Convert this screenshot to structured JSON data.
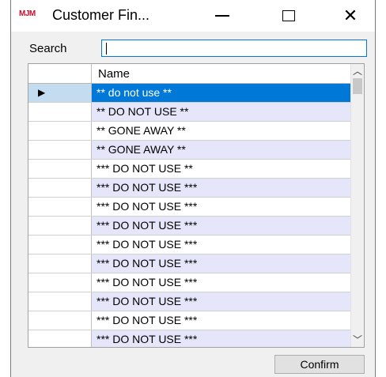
{
  "window": {
    "logo_text": "MJM",
    "title": "Customer Fin...",
    "min_glyph": "—",
    "close_glyph": "✕"
  },
  "search": {
    "label": "Search",
    "value": ""
  },
  "grid": {
    "column_header": "Name",
    "current_row_glyph": "▶",
    "rows": [
      "** do not use **",
      "** DO NOT USE **",
      "** GONE AWAY **",
      "** GONE AWAY **",
      "*** DO NOT USE **",
      "*** DO NOT USE ***",
      "*** DO NOT USE ***",
      "*** DO NOT USE ***",
      "*** DO NOT USE ***",
      "*** DO NOT USE ***",
      "*** DO NOT USE ***",
      "*** DO NOT USE ***",
      "*** DO NOT USE ***",
      "*** DO NOT USE ***"
    ],
    "scroll_up_glyph": "︿",
    "scroll_down_glyph": "﹀"
  },
  "actions": {
    "confirm_label": "Confirm"
  },
  "colors": {
    "selection": "#0078d7",
    "alt_row": "#e6e6fa",
    "logo": "#c8102e"
  }
}
